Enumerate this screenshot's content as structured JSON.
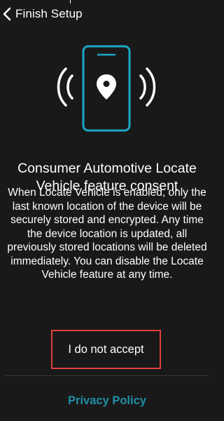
{
  "header": {
    "title": "Finish Setup",
    "back_icon": "chevron-left-icon"
  },
  "illustration": {
    "icon": "phone-location-icon",
    "accent_color": "#1aa6c6"
  },
  "consent": {
    "title": "Consumer Automotive Locate Vehicle feature consent",
    "body": "When Locate Vehicle is enabled, only the last known location of the device will be securely stored and encrypted. Any time the device location is updated, all previously stored locations will be deleted immediately. You can disable the Locate Vehicle feature at any time."
  },
  "actions": {
    "decline_label": "I do not accept",
    "highlight_color": "#e0403d"
  },
  "footer": {
    "privacy_link": "Privacy Policy",
    "link_color": "#1f8fa6"
  }
}
